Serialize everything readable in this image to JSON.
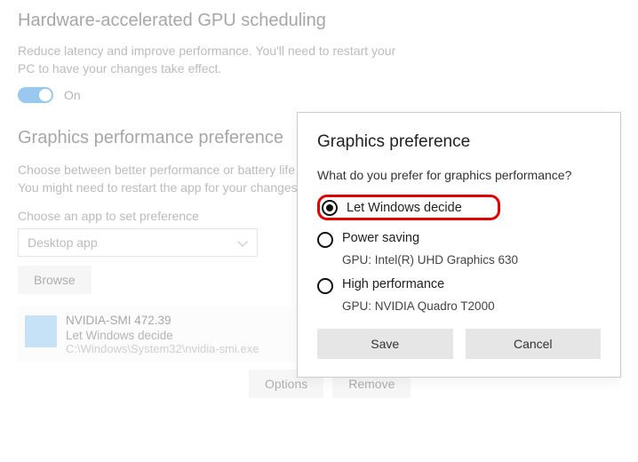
{
  "gpu": {
    "heading": "Hardware-accelerated GPU scheduling",
    "description": "Reduce latency and improve performance. You'll need to restart your PC to have your changes take effect.",
    "toggle_state": "On"
  },
  "perf": {
    "heading": "Graphics performance preference",
    "description": "Choose between better performance or battery life when using an app. You might need to restart the app for your changes to take effect.",
    "choose_label": "Choose an app to set preference",
    "dropdown_value": "Desktop app",
    "browse_label": "Browse",
    "app": {
      "name": "NVIDIA-SMI 472.39",
      "pref": "Let Windows decide",
      "path": "C:\\Windows\\System32\\nvidia-smi.exe"
    },
    "options_label": "Options",
    "remove_label": "Remove"
  },
  "modal": {
    "title": "Graphics preference",
    "question": "What do you prefer for graphics performance?",
    "options": {
      "0": {
        "label": "Let Windows decide"
      },
      "1": {
        "label": "Power saving",
        "detail": "GPU: Intel(R) UHD Graphics 630"
      },
      "2": {
        "label": "High performance",
        "detail": "GPU: NVIDIA Quadro T2000"
      }
    },
    "save_label": "Save",
    "cancel_label": "Cancel"
  }
}
